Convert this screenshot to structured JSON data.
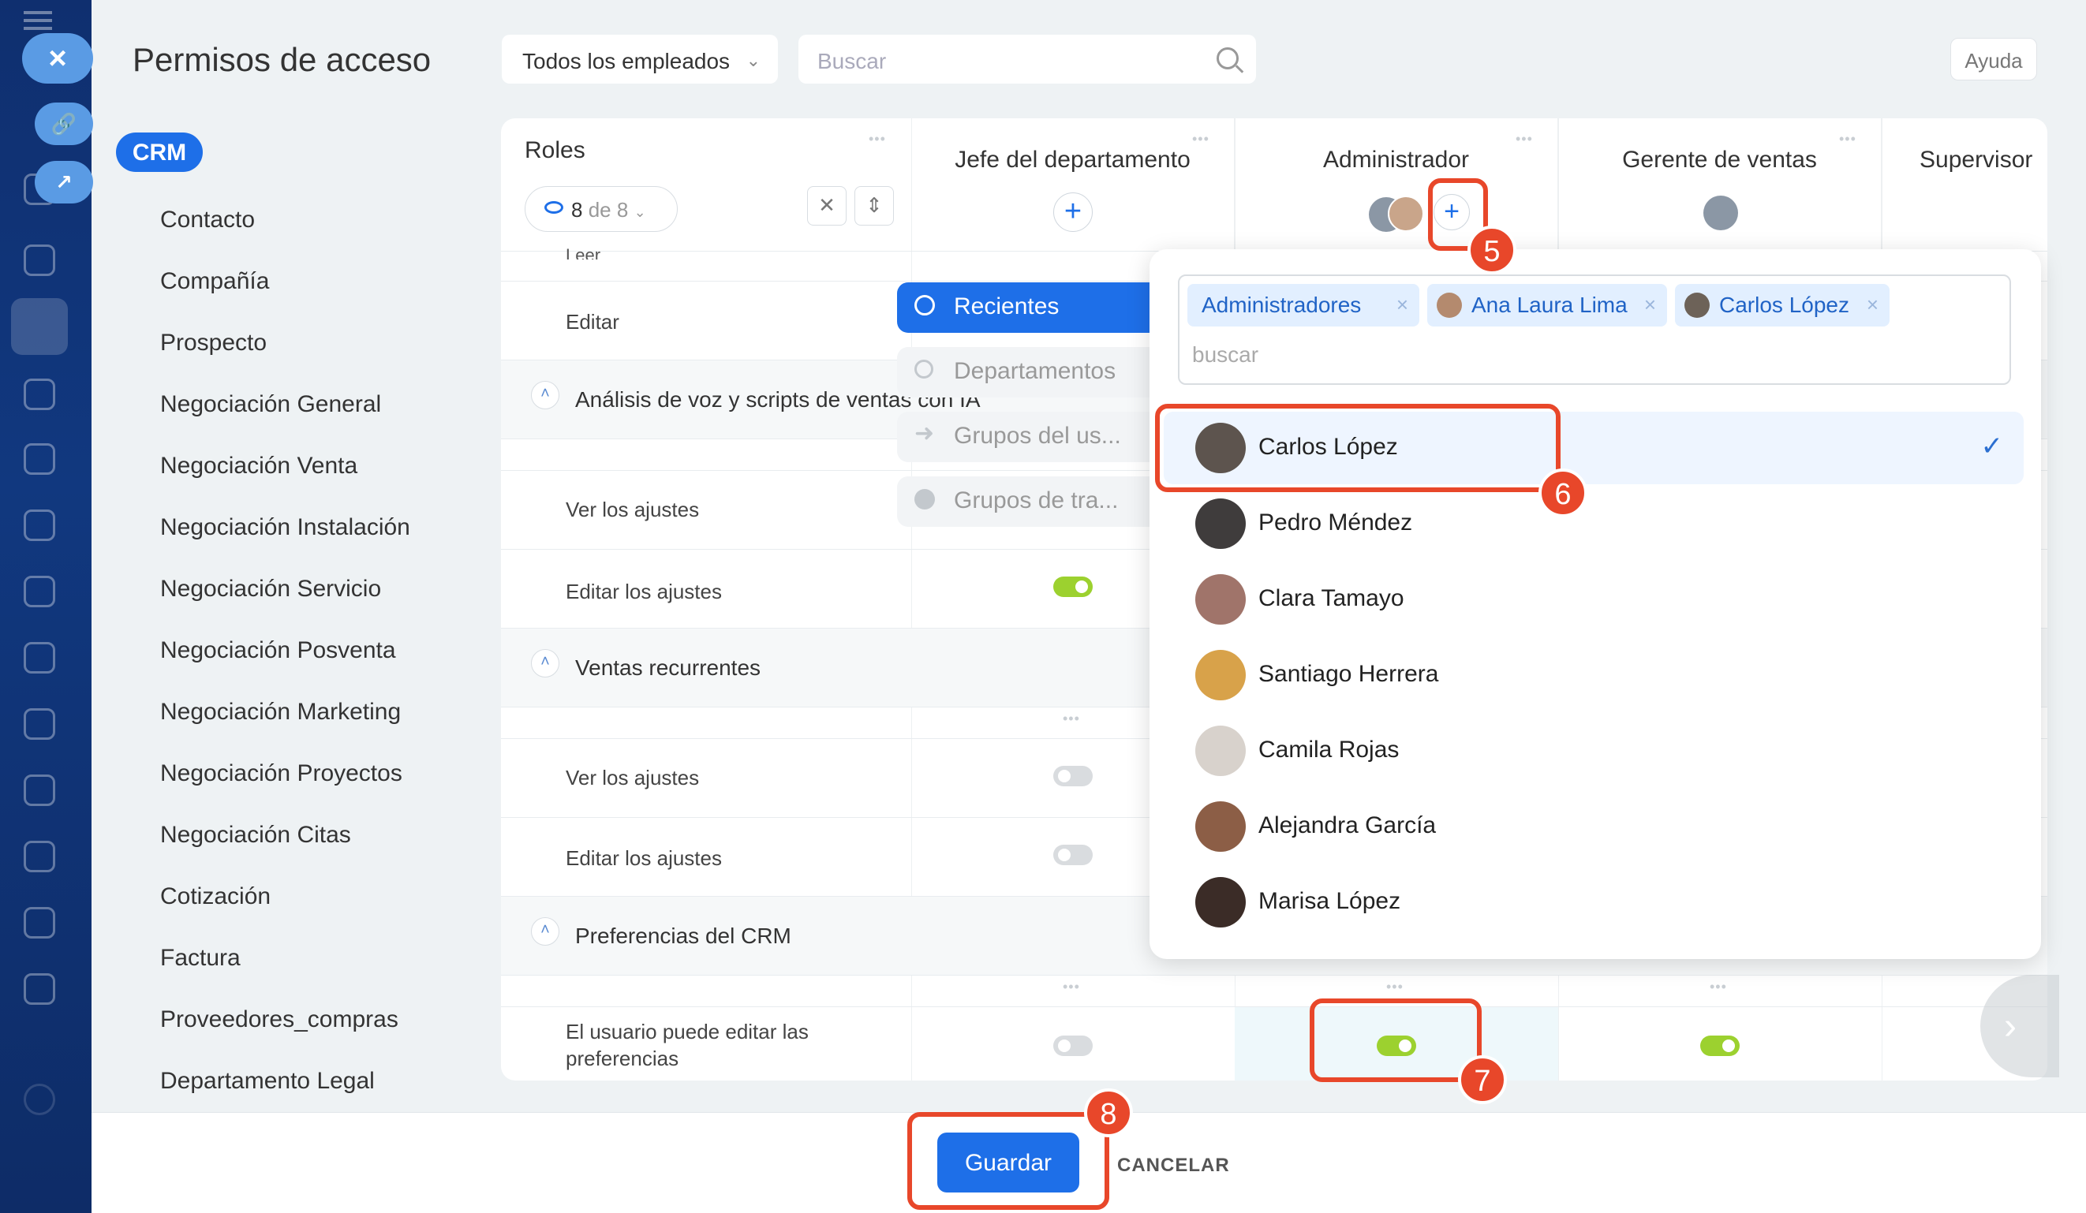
{
  "header": {
    "title": "Permisos de acceso",
    "employee_filter": "Todos los empleados",
    "search_placeholder": "Buscar",
    "help_label": "Ayuda"
  },
  "sidebar": {
    "active_pill": "CRM",
    "items": [
      "Contacto",
      "Compañía",
      "Prospecto",
      "Negociación General",
      "Negociación Venta",
      "Negociación Instalación",
      "Negociación Servicio",
      "Negociación Posventa",
      "Negociación Marketing",
      "Negociación Proyectos",
      "Negociación Citas",
      "Cotización",
      "Factura",
      "Proveedores_compras",
      "Departamento Legal"
    ]
  },
  "table": {
    "roles_label": "Roles",
    "counter": {
      "shown": "8",
      "sep": "de",
      "total": "8"
    },
    "columns": [
      "Jefe del departamento",
      "Administrador",
      "Gerente de ventas",
      "Supervisor"
    ],
    "rows": [
      {
        "type": "item",
        "label": "Leer"
      },
      {
        "type": "item",
        "label": "Editar"
      },
      {
        "type": "section",
        "label": "Análisis de voz y scripts de ventas con IA"
      },
      {
        "type": "item",
        "label": "Ver los ajustes"
      },
      {
        "type": "item",
        "label": "Editar los ajustes",
        "jefe_on": true
      },
      {
        "type": "section",
        "label": "Ventas recurrentes"
      },
      {
        "type": "item",
        "label": "Ver los ajustes",
        "jefe_on": false
      },
      {
        "type": "item",
        "label": "Editar los ajustes",
        "jefe_on": false
      },
      {
        "type": "section",
        "label": "Preferencias del CRM"
      },
      {
        "type": "item",
        "label": "El usuario puede editar las preferencias",
        "jefe_on": false,
        "admin_on": true,
        "gerente_on": true
      }
    ]
  },
  "selector": {
    "categories": [
      {
        "label": "Recientes",
        "active": true
      },
      {
        "label": "Departamentos",
        "active": false
      },
      {
        "label": "Grupos del us...",
        "active": false
      },
      {
        "label": "Grupos de tra...",
        "active": false
      }
    ],
    "tags": [
      "Administradores",
      "Ana Laura Lima",
      "Carlos López"
    ],
    "search_placeholder": "buscar",
    "people": [
      {
        "name": "Carlos López",
        "selected": true
      },
      {
        "name": "Pedro Méndez",
        "selected": false
      },
      {
        "name": "Clara Tamayo",
        "selected": false
      },
      {
        "name": "Santiago Herrera",
        "selected": false
      },
      {
        "name": "Camila Rojas",
        "selected": false
      },
      {
        "name": "Alejandra García",
        "selected": false
      },
      {
        "name": "Marisa López",
        "selected": false
      }
    ]
  },
  "footer": {
    "save_label": "Guardar",
    "cancel_label": "CANCELAR"
  },
  "callouts": [
    "5",
    "6",
    "7",
    "8"
  ],
  "colors": {
    "accent": "#1e6fe8",
    "toggle_on": "#9cd12f",
    "callout": "#e8472a"
  }
}
